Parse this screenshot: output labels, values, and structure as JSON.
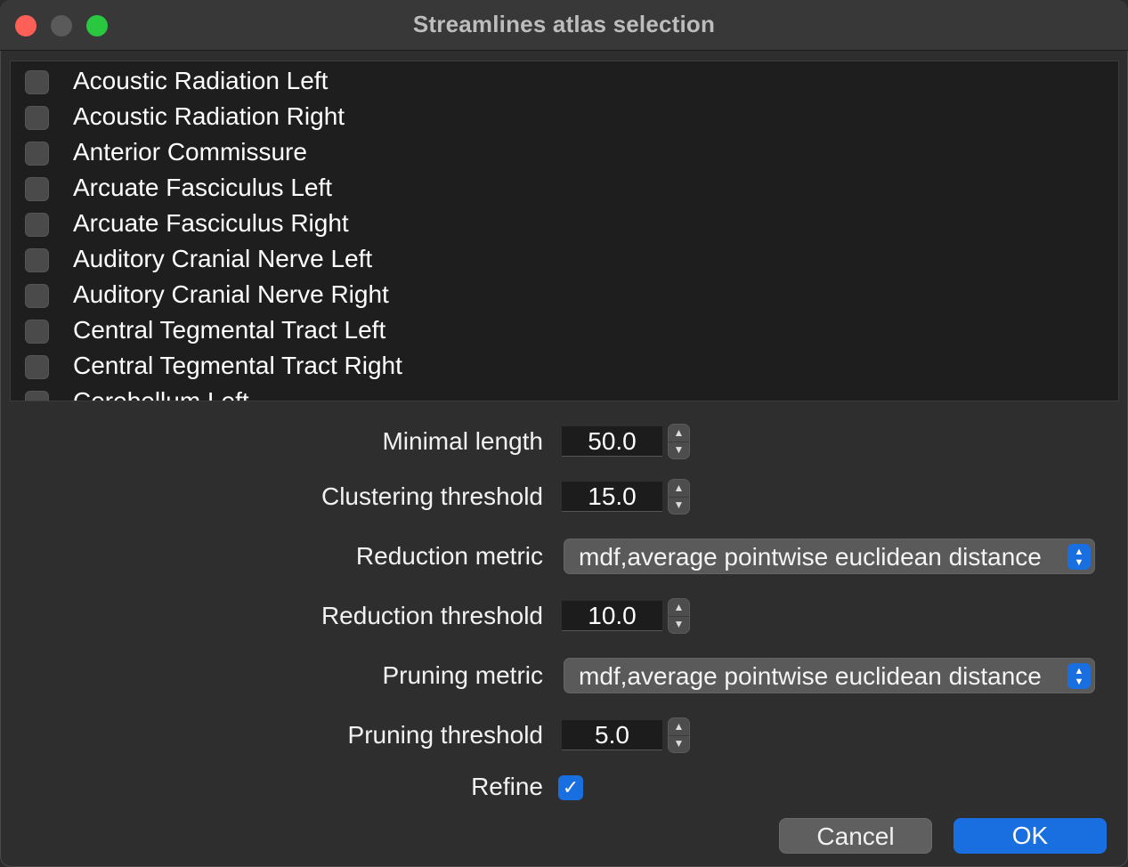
{
  "window": {
    "title": "Streamlines atlas selection"
  },
  "atlas_list": {
    "items": [
      {
        "label": "Acoustic Radiation Left",
        "checked": false
      },
      {
        "label": "Acoustic Radiation Right",
        "checked": false
      },
      {
        "label": "Anterior Commissure",
        "checked": false
      },
      {
        "label": "Arcuate Fasciculus Left",
        "checked": false
      },
      {
        "label": "Arcuate Fasciculus Right",
        "checked": false
      },
      {
        "label": "Auditory Cranial Nerve Left",
        "checked": false
      },
      {
        "label": "Auditory Cranial Nerve Right",
        "checked": false
      },
      {
        "label": "Central Tegmental Tract Left",
        "checked": false
      },
      {
        "label": "Central Tegmental Tract Right",
        "checked": false
      },
      {
        "label": "Cerebellum Left",
        "checked": false
      }
    ]
  },
  "form": {
    "minimal_length": {
      "label": "Minimal length",
      "value": "50.0"
    },
    "clustering_threshold": {
      "label": "Clustering threshold",
      "value": "15.0"
    },
    "reduction_metric": {
      "label": "Reduction metric",
      "value": "mdf,average pointwise euclidean distance"
    },
    "reduction_threshold": {
      "label": "Reduction threshold",
      "value": "10.0"
    },
    "pruning_metric": {
      "label": "Pruning metric",
      "value": "mdf,average pointwise euclidean distance"
    },
    "pruning_threshold": {
      "label": "Pruning threshold",
      "value": "5.0"
    },
    "refine": {
      "label": "Refine",
      "checked": true
    }
  },
  "buttons": {
    "cancel": "Cancel",
    "ok": "OK"
  },
  "colors": {
    "accent": "#1a6fe0",
    "close": "#fe5f57",
    "maximize": "#2ac840"
  }
}
